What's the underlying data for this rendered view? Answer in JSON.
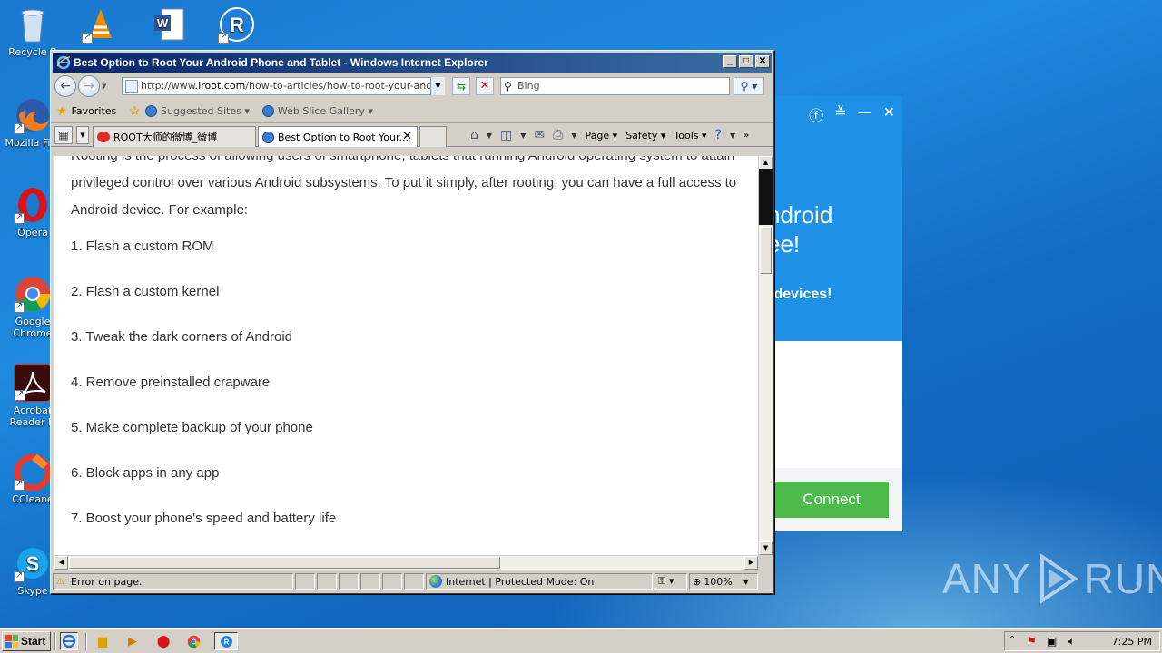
{
  "desktop": {
    "icons": [
      {
        "label": "Recycle B",
        "icon": "recycle-bin-icon"
      },
      {
        "label": "Mozilla Fire",
        "icon": "firefox-icon"
      },
      {
        "label": "Opera",
        "icon": "opera-icon"
      },
      {
        "label": "Google Chrome",
        "icon": "chrome-icon"
      },
      {
        "label": "Acrobat Reader D",
        "icon": "acrobat-icon"
      },
      {
        "label": "CCleane",
        "icon": "ccleaner-icon"
      },
      {
        "label": "Skype",
        "icon": "skype-icon"
      }
    ]
  },
  "popup": {
    "line1": "ndroid",
    "line2": "ee!",
    "line3": ".devices!",
    "connect_label": "Connect"
  },
  "browser": {
    "title": "Best Option to Root Your Android Phone and Tablet - Windows Internet Explorer",
    "address": {
      "prefix": "http://www.",
      "domain": "iroot.com",
      "path": "/how-to-articles/how-to-root-your-android-p"
    },
    "search_placeholder": "Bing",
    "favorites": {
      "favorites_label": "Favorites",
      "suggested_label": "Suggested Sites ▾",
      "slice_label": "Web Slice Gallery ▾"
    },
    "tabs": [
      {
        "label": "ROOT大师的微博_微博"
      },
      {
        "label": "Best Option to Root Your..."
      }
    ],
    "commands": {
      "page": "Page ▾",
      "safety": "Safety ▾",
      "tools": "Tools ▾"
    },
    "content": {
      "para1_line1": "Rooting is the process of allowing users of smartphone, tablets that running Android operating system to attain",
      "para1_line2": "privileged control over various Android subsystems. To put it simply, after rooting, you can have a full access to",
      "para1_line3": "Android device. For example:",
      "items": [
        "1. Flash a custom ROM",
        "2. Flash a custom kernel",
        "3. Tweak the dark corners of Android",
        "4. Remove preinstalled crapware",
        "5. Make complete backup of your phone",
        "6. Block apps in any app",
        "7. Boost your phone's speed and battery life"
      ]
    },
    "status": {
      "error": "Error on page.",
      "zone": "Internet | Protected Mode: On",
      "zoom": "100%"
    }
  },
  "taskbar": {
    "start_label": "Start",
    "clock": "7:25 PM"
  },
  "watermark": {
    "left": "ANY",
    "right": "RUN"
  }
}
